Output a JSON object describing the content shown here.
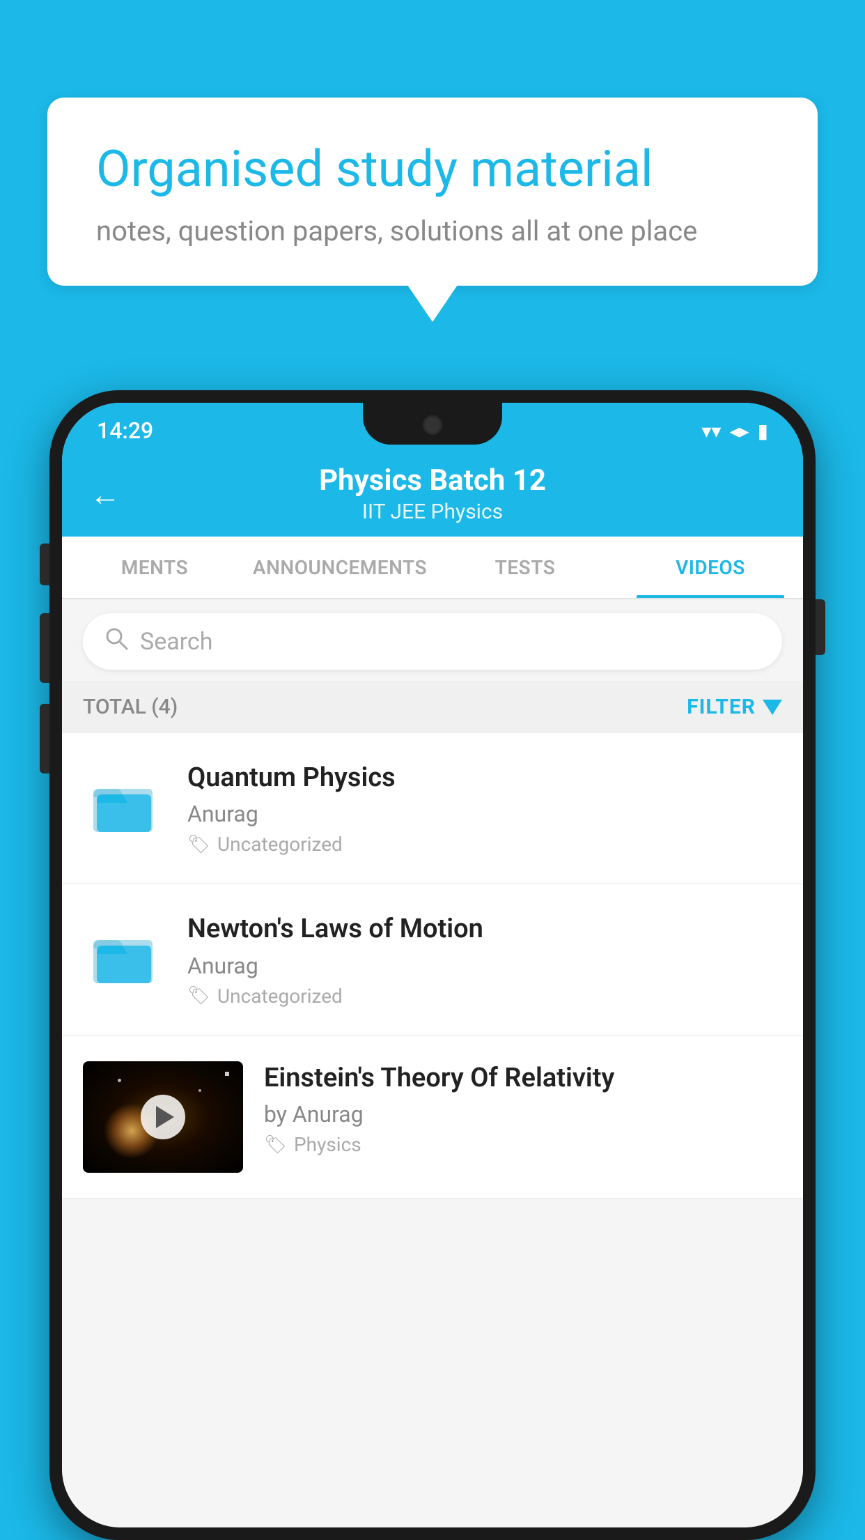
{
  "background_color": "#1bb8e8",
  "speech_bubble": {
    "title": "Organised study material",
    "subtitle": "notes, question papers, solutions all at one place"
  },
  "phone": {
    "status_bar": {
      "time": "14:29",
      "wifi": "▼",
      "signal": "▲",
      "battery": "▮"
    },
    "header": {
      "back_label": "←",
      "title": "Physics Batch 12",
      "tags": "IIT JEE   Physics"
    },
    "tabs": [
      {
        "label": "MENTS",
        "active": false
      },
      {
        "label": "ANNOUNCEMENTS",
        "active": false
      },
      {
        "label": "TESTS",
        "active": false
      },
      {
        "label": "VIDEOS",
        "active": true
      }
    ],
    "search": {
      "placeholder": "Search"
    },
    "filter_bar": {
      "total_label": "TOTAL (4)",
      "filter_label": "FILTER"
    },
    "videos": [
      {
        "id": "quantum",
        "title": "Quantum Physics",
        "author": "Anurag",
        "tag": "Uncategorized",
        "has_thumbnail": false
      },
      {
        "id": "newton",
        "title": "Newton's Laws of Motion",
        "author": "Anurag",
        "tag": "Uncategorized",
        "has_thumbnail": false
      },
      {
        "id": "einstein",
        "title": "Einstein's Theory Of Relativity",
        "author": "by Anurag",
        "tag": "Physics",
        "has_thumbnail": true
      }
    ]
  }
}
